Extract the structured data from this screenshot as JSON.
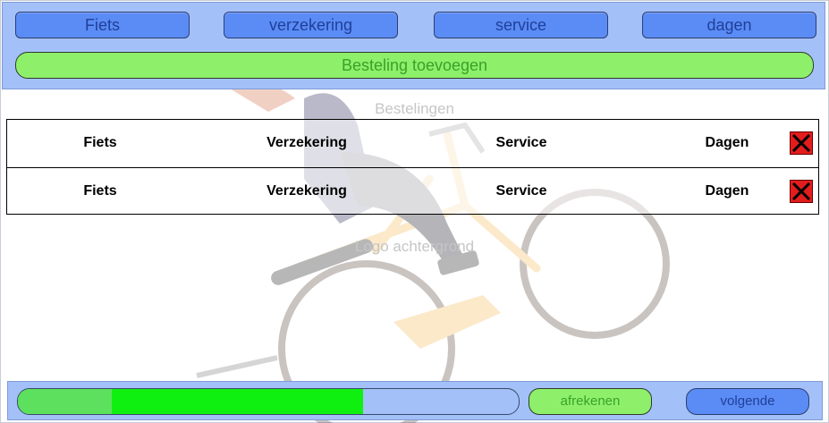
{
  "nav": {
    "tabs": [
      {
        "label": "Fiets"
      },
      {
        "label": "verzekering"
      },
      {
        "label": "service"
      },
      {
        "label": "dagen"
      }
    ],
    "add_order_label": "Besteling toevoegen"
  },
  "orders": {
    "title": "Bestelingen",
    "rows": [
      {
        "bike": "Fiets",
        "insurance": "Verzekering",
        "service": "Service",
        "days": "Dagen"
      },
      {
        "bike": "Fiets",
        "insurance": "Verzekering",
        "service": "Service",
        "days": "Dagen"
      }
    ]
  },
  "background": {
    "label": "Logo achtergrond"
  },
  "footer": {
    "progress_percent": 69,
    "checkout_label": "afrekenen",
    "next_label": "volgende"
  },
  "colors": {
    "nav_bar": "#a4c0f8",
    "blue_button": "#5b8cf5",
    "green_button": "#8ef06a",
    "progress_fill": "#10f010",
    "delete": "#e31c1c"
  },
  "icons": {
    "delete": "x-icon",
    "background": "bicycle-rider-illustration"
  }
}
